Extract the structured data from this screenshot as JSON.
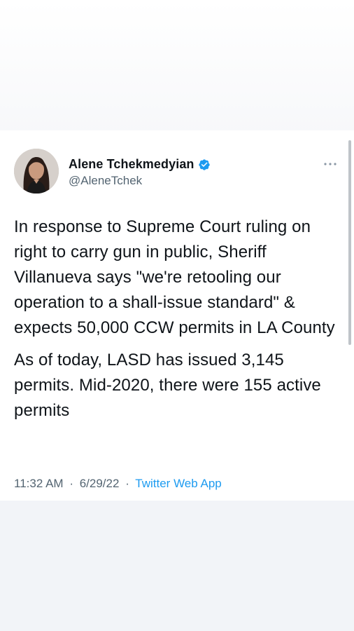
{
  "tweet": {
    "author": {
      "display_name": "Alene Tchekmedyian",
      "handle": "@AleneTchek",
      "verified": true
    },
    "paragraphs": [
      "In response to Supreme Court ruling on right to carry gun in public, Sheriff Villanueva says \"we're retooling our operation to a shall-issue standard\" & expects 50,000 CCW permits in LA County",
      "As of today, LASD has issued 3,145 permits. Mid-2020, there were 155 active permits"
    ],
    "meta": {
      "time": "11:32 AM",
      "separator": "·",
      "date": "6/29/22",
      "source": "Twitter Web App"
    }
  },
  "icons": {
    "verified": "verified-badge-icon",
    "more": "more-options-icon"
  },
  "colors": {
    "link": "#1d9bf0",
    "verified": "#1d9bf0",
    "secondary_text": "#536471",
    "primary_text": "#0f1419"
  }
}
